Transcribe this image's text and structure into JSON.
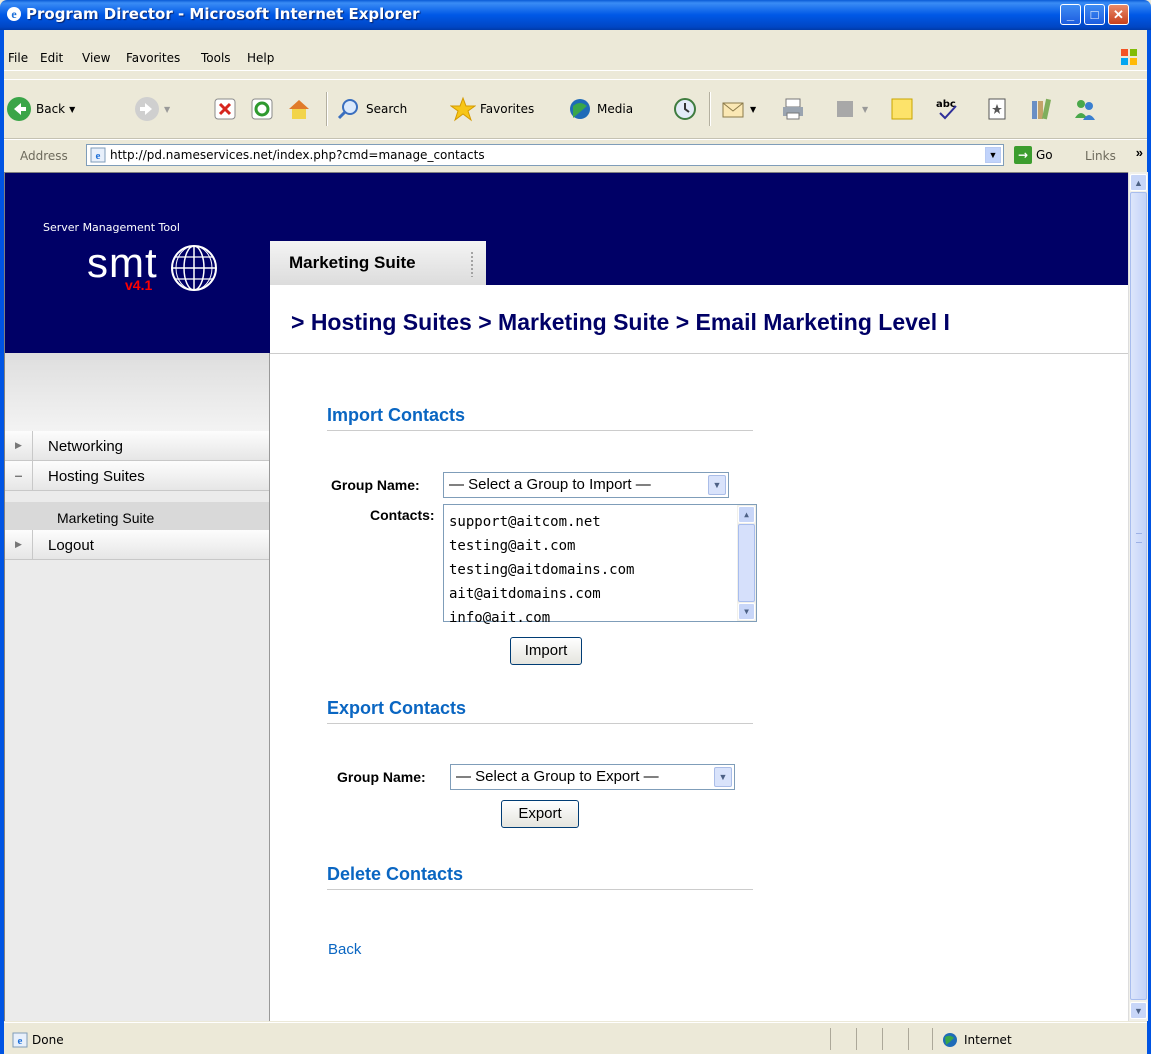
{
  "window": {
    "title": "Program Director - Microsoft Internet Explorer"
  },
  "menu": [
    "File",
    "Edit",
    "View",
    "Favorites",
    "Tools",
    "Help"
  ],
  "toolbar": {
    "back": "Back",
    "search": "Search",
    "favorites": "Favorites",
    "media": "Media"
  },
  "address": {
    "label": "Address",
    "url": "http://pd.nameservices.net/index.php?cmd=manage_contacts",
    "go": "Go",
    "links": "Links"
  },
  "logo": {
    "subtitle": "Server Management Tool",
    "name": "smt",
    "version": "v4.1"
  },
  "tab": {
    "label": "Marketing Suite"
  },
  "breadcrumb": "> Hosting Suites > Marketing Suite > Email Marketing Level I",
  "sidebar": {
    "items": [
      {
        "label": "Networking"
      },
      {
        "label": "Hosting Suites"
      },
      {
        "label": "Marketing Suite"
      },
      {
        "label": "Logout"
      }
    ]
  },
  "import": {
    "heading": "Import Contacts",
    "group_label": "Group Name:",
    "group_value": "— Select a Group to Import —",
    "contacts_label": "Contacts:",
    "contacts": [
      "support@aitcom.net",
      "testing@ait.com",
      "testing@aitdomains.com",
      "ait@aitdomains.com",
      "info@ait.com"
    ],
    "button": "Import"
  },
  "export": {
    "heading": "Export Contacts",
    "group_label": "Group Name:",
    "group_value": "— Select a Group to Export —",
    "button": "Export"
  },
  "delete": {
    "heading": "Delete Contacts"
  },
  "back_link": "Back",
  "status": {
    "left": "Done",
    "zone": "Internet"
  }
}
